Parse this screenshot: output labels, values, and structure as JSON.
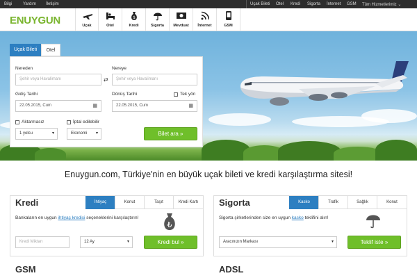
{
  "topbar": {
    "left": [
      "Bilgi",
      "Yardım",
      "İletişim"
    ],
    "right": [
      "Uçak Bileti",
      "Otel",
      "Kredi",
      "Sigorta",
      "İnternet",
      "GSM",
      "Tüm Hizmetlerimiz ⌄"
    ]
  },
  "header": {
    "logo": "ENUYGUN",
    "nav": [
      {
        "label": "Uçak",
        "icon": "plane-icon"
      },
      {
        "label": "Otel",
        "icon": "bed-icon"
      },
      {
        "label": "Kredi",
        "icon": "money-bag-icon"
      },
      {
        "label": "Sigorta",
        "icon": "umbrella-icon"
      },
      {
        "label": "Mevduat",
        "icon": "banknote-icon"
      },
      {
        "label": "İnternet",
        "icon": "wifi-icon"
      },
      {
        "label": "GSM",
        "icon": "phone-icon"
      }
    ]
  },
  "search": {
    "tabs": [
      "Uçak Bileti",
      "Otel"
    ],
    "from_label": "Nereden",
    "from_placeholder": "Şehir veya Havalimanı",
    "to_label": "Nereye",
    "to_placeholder": "Şehir veya Havalimanı",
    "depart_label": "Gidiş Tarihi",
    "depart_value": "22.05.2015, Cum",
    "return_label": "Dönüş Tarihi",
    "return_value": "22.05.2015, Cum",
    "oneway_label": "Tek yön",
    "transfer_label": "Aktarmasız",
    "cancel_label": "İptal edilebilir",
    "passenger_value": "1 yolcu",
    "class_value": "Ekonomi",
    "submit_label": "Bilet ara »"
  },
  "tagline": "Enuygun.com, Türkiye'nin en büyük uçak bileti ve kredi karşılaştırma sitesi!",
  "kredi": {
    "title": "Kredi",
    "tabs": [
      "İhtiyaç",
      "Konut",
      "Taşıt",
      "Kredi Kartı"
    ],
    "text_before": "Bankaların en uygun ",
    "text_link": "ihtiyaç kredisi",
    "text_after": " seçeneklerini karşılaştırın!",
    "amount_placeholder": "Kredi Miktarı",
    "term_value": "12 Ay",
    "button": "Kredi bul »"
  },
  "sigorta": {
    "title": "Sigorta",
    "tabs": [
      "Kasko",
      "Trafik",
      "Sağlık",
      "Konut"
    ],
    "text_before": "Sigorta şirketlerinden size en uygun ",
    "text_link": "kasko",
    "text_after": " teklifini alın!",
    "brand_value": "Aracınızın Markası",
    "button": "Teklif iste »"
  },
  "bottom": {
    "gsm": "GSM",
    "adsl": "ADSL"
  },
  "colors": {
    "brand": "#7ab52f",
    "accent_blue": "#2d7fc1",
    "button_green": "#6fbf2a"
  }
}
